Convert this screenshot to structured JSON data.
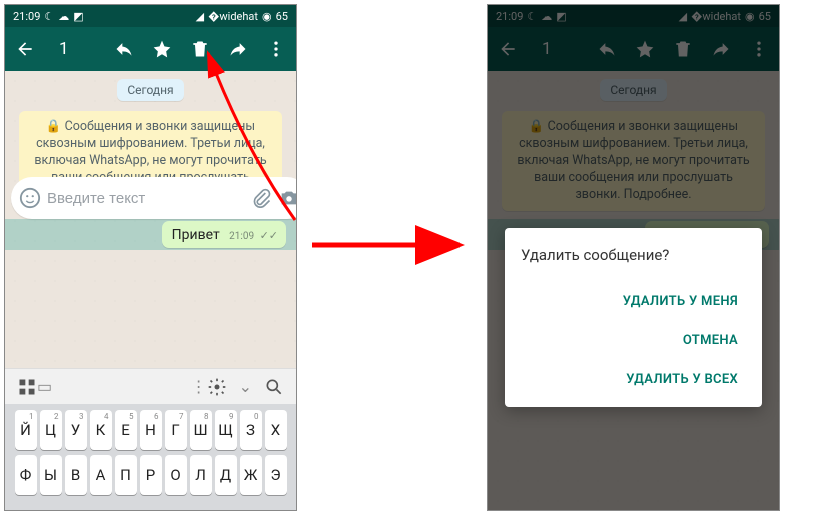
{
  "status": {
    "time": "21:09",
    "battery": "65"
  },
  "appbar": {
    "selected_count": "1"
  },
  "chat": {
    "date_label": "Сегодня",
    "encryption_notice": "🔒 Сообщения и звонки защищены сквозным шифрованием. Третьи лица, включая WhatsApp, не могут прочитать ваши сообщения или прослушать звонки. Подробнее.",
    "message_text": "Привет",
    "message_time": "21:09"
  },
  "input": {
    "placeholder": "Введите текст"
  },
  "keyboard": {
    "row1": [
      "Й",
      "Ц",
      "У",
      "К",
      "Е",
      "Н",
      "Г",
      "Ш",
      "Щ",
      "З",
      "Х"
    ],
    "row1nums": [
      "1",
      "2",
      "3",
      "4",
      "5",
      "6",
      "7",
      "8",
      "9",
      "0",
      ""
    ],
    "row2": [
      "Ф",
      "Ы",
      "В",
      "А",
      "П",
      "Р",
      "О",
      "Л",
      "Д",
      "Ж",
      "Э"
    ]
  },
  "dialog": {
    "title": "Удалить сообщение?",
    "btn_delete_me": "УДАЛИТЬ У МЕНЯ",
    "btn_cancel": "ОТМЕНА",
    "btn_delete_all": "УДАЛИТЬ У ВСЕХ"
  }
}
